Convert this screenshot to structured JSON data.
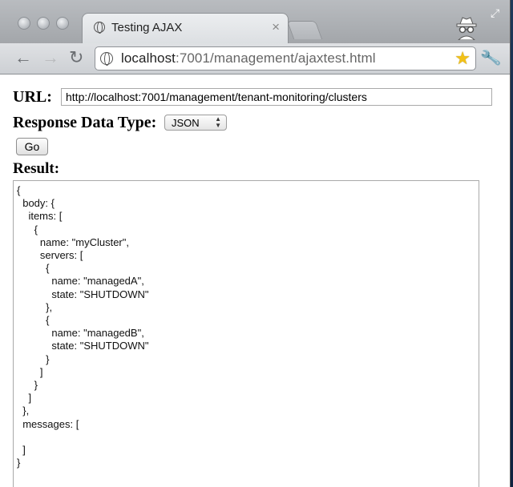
{
  "browser": {
    "tab_title": "Testing AJAX",
    "tab_close": "×",
    "url_host": "localhost",
    "url_path": ":7001/management/ajaxtest.html",
    "icons": [
      "back-icon",
      "forward-icon",
      "reload-icon",
      "globe-icon",
      "star-icon",
      "wrench-icon",
      "incognito-icon"
    ]
  },
  "form": {
    "url_label": "URL:",
    "url_value": "http://localhost:7001/management/tenant-monitoring/clusters",
    "response_type_label": "Response Data Type:",
    "response_type_value": "JSON",
    "go_label": "Go",
    "result_label": "Result:"
  },
  "result_text": "{\n  body: {\n    items: [\n      {\n        name: \"myCluster\",\n        servers: [\n          {\n            name: \"managedA\",\n            state: \"SHUTDOWN\"\n          },\n          {\n            name: \"managedB\",\n            state: \"SHUTDOWN\"\n          }\n        ]\n      }\n    ]\n  },\n  messages: [\n\n  ]\n}"
}
